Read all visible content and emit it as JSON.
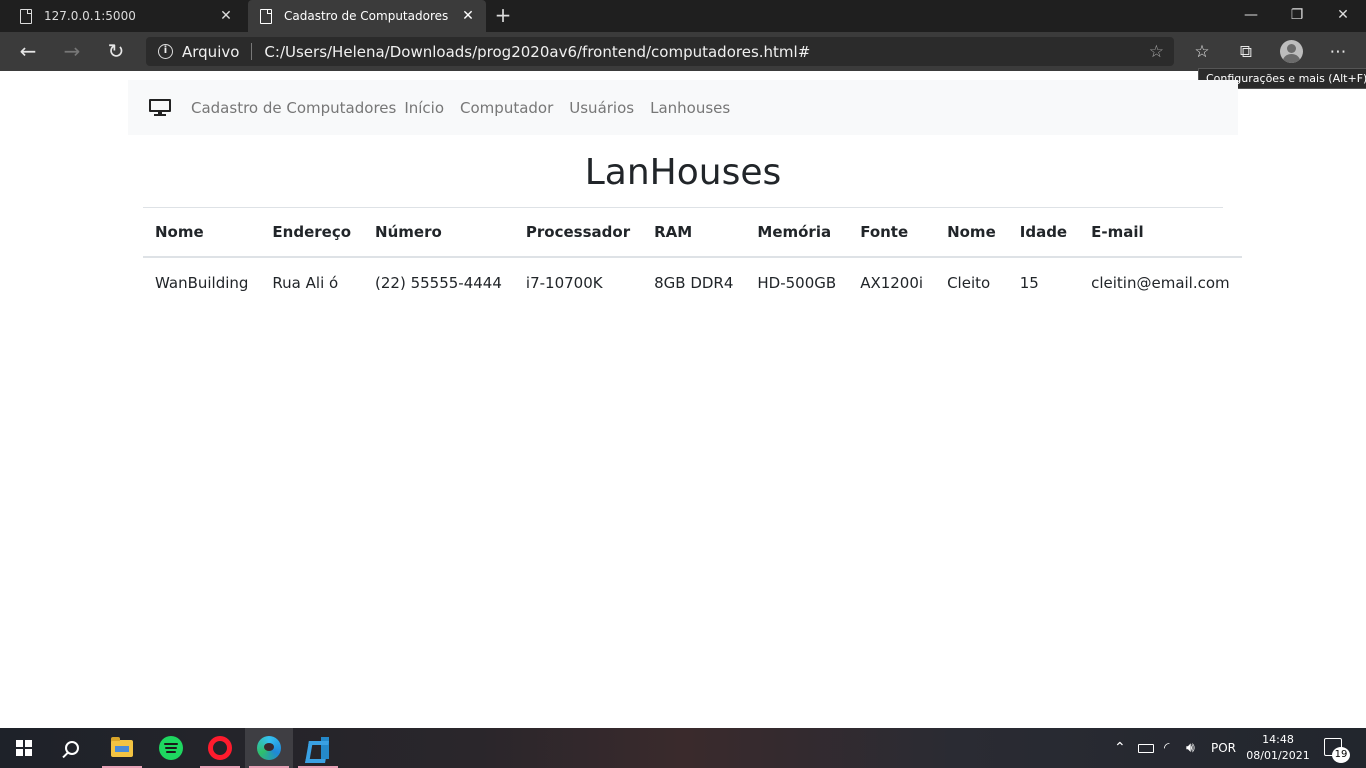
{
  "browser": {
    "tabs": [
      {
        "title": "127.0.0.1:5000"
      },
      {
        "title": "Cadastro de Computadores"
      }
    ],
    "address": {
      "site_label": "Arquivo",
      "url": "C:/Users/Helena/Downloads/prog2020av6/frontend/computadores.html#"
    },
    "tooltip": "Configurações e mais (Alt+F)"
  },
  "page": {
    "navbar": {
      "brand": "Cadastro de Computadores",
      "links": [
        "Início",
        "Computador",
        "Usuários",
        "Lanhouses"
      ]
    },
    "heading": "LanHouses",
    "table": {
      "headers": [
        "Nome",
        "Endereço",
        "Número",
        "Processador",
        "RAM",
        "Memória",
        "Fonte",
        "Nome",
        "Idade",
        "E-mail"
      ],
      "rows": [
        [
          "WanBuilding",
          "Rua Ali ó",
          "(22) 55555-4444",
          "i7-10700K",
          "8GB DDR4",
          "HD-500GB",
          "AX1200i",
          "Cleito",
          "15",
          "cleitin@email.com"
        ]
      ]
    }
  },
  "taskbar": {
    "apps": [
      "file-explorer",
      "spotify",
      "opera",
      "edge",
      "vscode"
    ],
    "tray": {
      "language": "POR",
      "time": "14:48",
      "date": "08/01/2021",
      "notifications": "19"
    }
  }
}
